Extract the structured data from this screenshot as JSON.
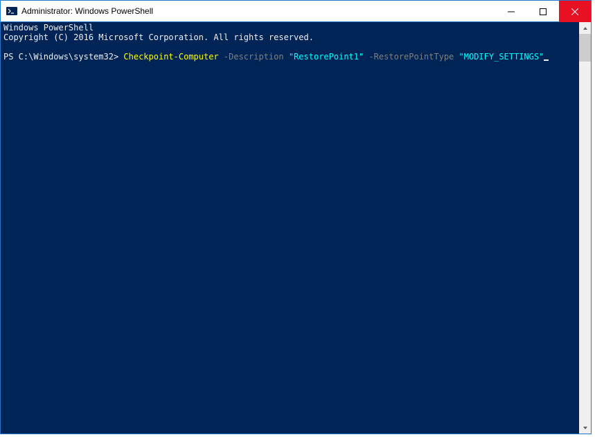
{
  "window": {
    "title": "Administrator: Windows PowerShell"
  },
  "console": {
    "banner_line1": "Windows PowerShell",
    "banner_line2": "Copyright (C) 2016 Microsoft Corporation. All rights reserved.",
    "prompt": "PS C:\\Windows\\system32> ",
    "command": {
      "cmdlet": "Checkpoint-Computer",
      "param1": "-Description",
      "arg1": "\"RestorePoint1\"",
      "param2": "-RestorePointType",
      "arg2": "\"MODIFY_SETTINGS\""
    }
  },
  "icons": {
    "powershell": "powershell-icon",
    "minimize": "minimize-icon",
    "maximize": "maximize-icon",
    "close": "close-icon",
    "scroll_up": "scroll-up-icon",
    "scroll_down": "scroll-down-icon"
  }
}
